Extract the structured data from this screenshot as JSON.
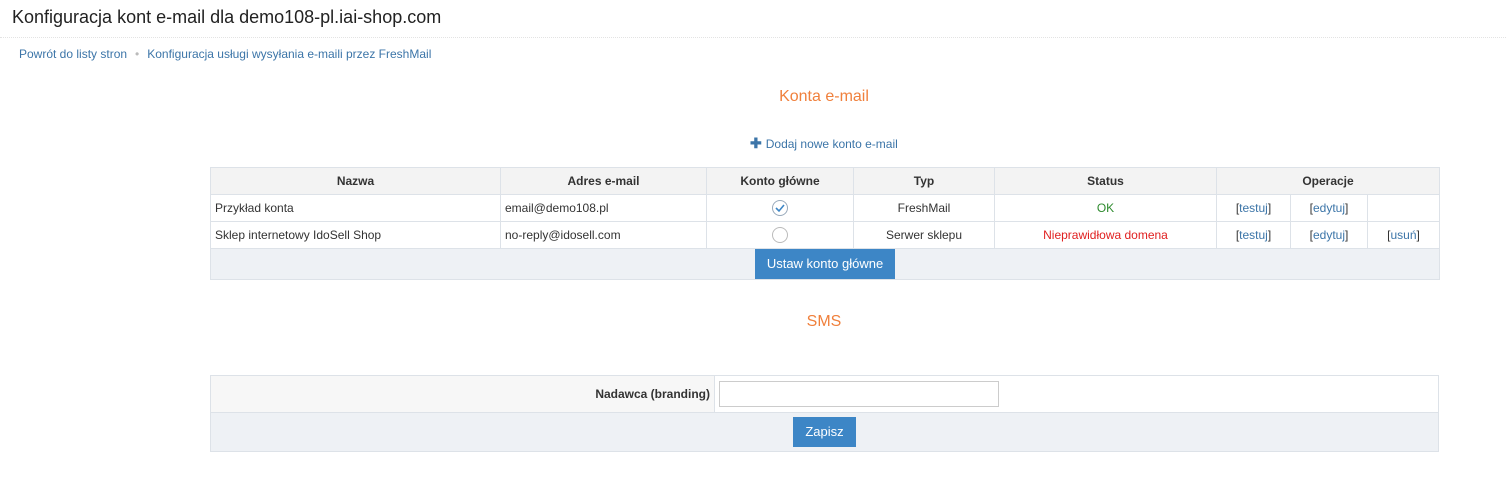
{
  "page": {
    "title": "Konfiguracja kont e-mail dla demo108-pl.iai-shop.com"
  },
  "breadcrumb": [
    {
      "label": "Powrót do listy stron"
    },
    {
      "label": "Konfiguracja usługi wysyłania e-maili przez FreshMail"
    }
  ],
  "accounts_section": {
    "title": "Konta e-mail",
    "add_link": "Dodaj nowe konto e-mail",
    "columns": [
      "Nazwa",
      "Adres e-mail",
      "Konto główne",
      "Typ",
      "Status",
      "Operacje"
    ],
    "rows": [
      {
        "name": "Przykład konta",
        "email": "email@demo108.pl",
        "main": true,
        "type": "FreshMail",
        "status": "OK",
        "status_color": "#2e8b2e",
        "ops": [
          "testuj",
          "edytuj"
        ]
      },
      {
        "name": "Sklep internetowy IdoSell Shop",
        "email": "no-reply@idosell.com",
        "main": false,
        "type": "Serwer sklepu",
        "status": "Nieprawidłowa domena",
        "status_color": "#e02020",
        "ops": [
          "testuj",
          "edytuj",
          "usuń"
        ]
      }
    ],
    "set_main_button": "Ustaw konto główne"
  },
  "sms_section": {
    "title": "SMS",
    "sender_label": "Nadawca (branding)",
    "sender_value": "",
    "save_button": "Zapisz"
  },
  "colors": {
    "accent": "#f0803c",
    "link": "#3c75a8",
    "button": "#3d86c6"
  }
}
